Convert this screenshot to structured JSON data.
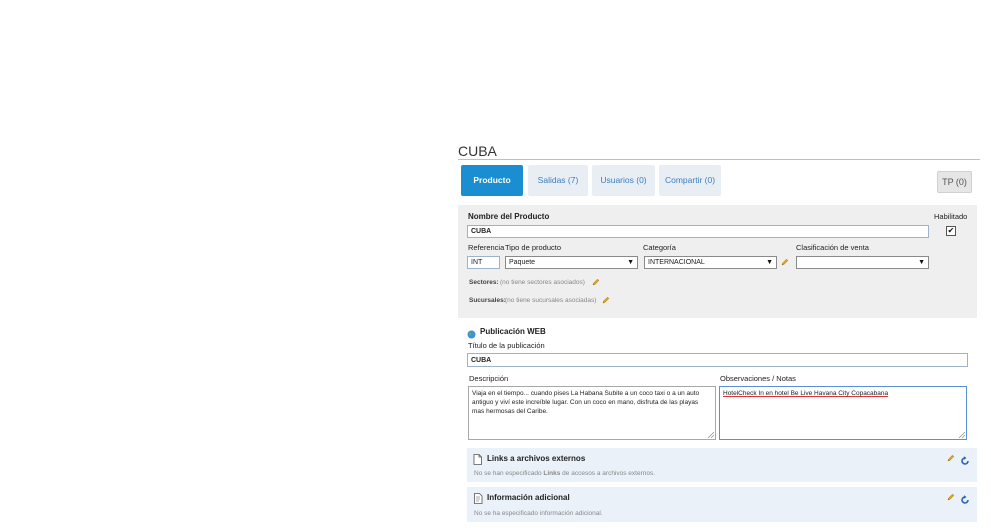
{
  "page": {
    "title": "CUBA"
  },
  "tabs": [
    {
      "label": "Producto",
      "active": true
    },
    {
      "label": "Salidas (7)",
      "active": false
    },
    {
      "label": "Usuarios (0)",
      "active": false
    },
    {
      "label": "Compartir (0)",
      "active": false
    }
  ],
  "tp_badge": "TP (0)",
  "product": {
    "name_label": "Nombre del Producto",
    "name_value": "CUBA",
    "enabled_label": "Habilitado",
    "enabled_checked": "✔",
    "ref_label": "Referencia",
    "ref_value": "INT",
    "type_label": "Tipo de producto",
    "type_value": "Paquete",
    "category_label": "Categoría",
    "category_value": "INTERNACIONAL",
    "sales_class_label": "Clasificación de venta",
    "sales_class_value": "",
    "sectors_label": "Sectores:",
    "sectors_value": "(no tiene sectores asociados)",
    "branches_label": "Sucursales:",
    "branches_value": "(no tiene sucursales asociadas)"
  },
  "web": {
    "section_title": "Publicación WEB",
    "pub_title_label": "Título de la publicación",
    "pub_title_value": "CUBA",
    "desc_label": "Descripción",
    "desc_value": "Viaja en el tiempo... cuando pises La Habana Subite a un coco taxi o a un auto antiguo y viví este increíble lugar. Con un coco en mano, disfruta de las playas mas hermosas del Caribe.",
    "notes_label": "Observaciones / Notas",
    "notes_value": "HotelCheck In en hotel Be Live Havana City Copacabana"
  },
  "links": {
    "title": "Links a archivos externos",
    "note_pre": "No se han especificado ",
    "note_bold": "Links",
    "note_post": " de accesos a archivos externos."
  },
  "additional": {
    "title": "Información adicional",
    "note": "No se ha especificado información adicional."
  },
  "colors": {
    "accent": "#1a8ed1",
    "tab_bg": "#e9eef4",
    "panel_bg": "#efefef",
    "box_bg": "#eaf1f8"
  }
}
